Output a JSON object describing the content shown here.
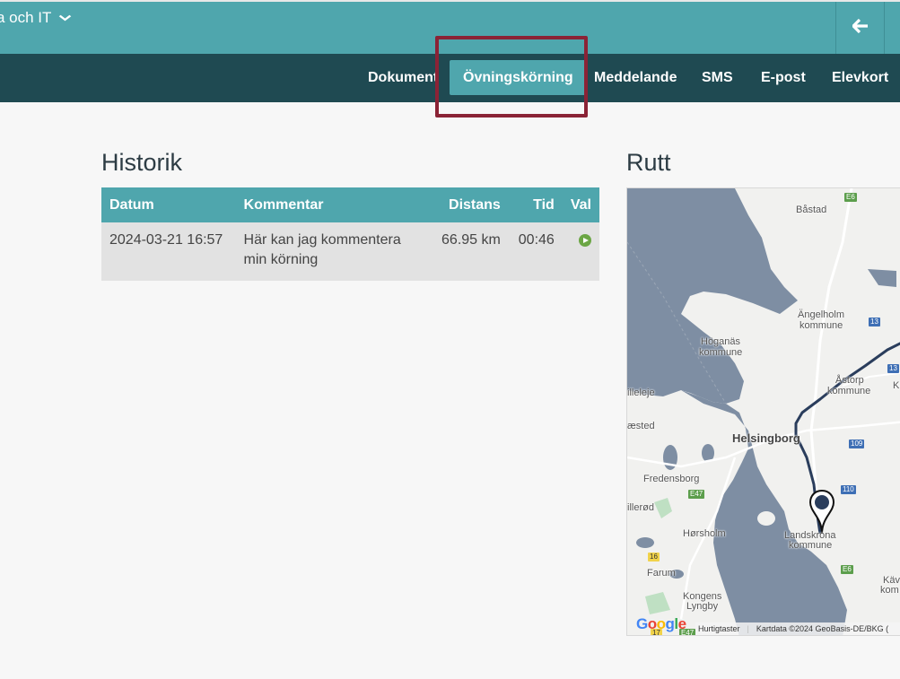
{
  "topbar": {
    "org_label": "a och IT",
    "back_icon": "arrow-left-icon"
  },
  "nav": {
    "items": [
      {
        "label": "Dokument"
      },
      {
        "label": "Övningskörning",
        "active": true
      },
      {
        "label": "Meddelande"
      },
      {
        "label": "SMS"
      },
      {
        "label": "E-post"
      },
      {
        "label": "Elevkort"
      }
    ]
  },
  "history": {
    "title": "Historik",
    "columns": [
      "Datum",
      "Kommentar",
      "Distans",
      "Tid",
      "Val"
    ],
    "rows": [
      {
        "datum": "2024-03-21 16:57",
        "kommentar": "Här kan jag kommentera min körning",
        "distans": "66.95 km",
        "tid": "00:46",
        "val_icon": "play-icon"
      }
    ]
  },
  "route": {
    "title": "Rutt",
    "map_labels": {
      "bastad": "Båstad",
      "angelholm_1": "Ängelholm",
      "angelholm_2": "kommune",
      "hoganas_1": "Höganäs",
      "hoganas_2": "kommune",
      "astorp_1": "Åstorp",
      "astorp_2": "kommune",
      "kl": "Kl",
      "lleleje": "illeleje",
      "aested": "æsted",
      "helsingborg": "Helsingborg",
      "fredensborg": "Fredensborg",
      "illerod": "illerød",
      "horsholm": "Hørsholm",
      "landskrona_1": "Landskrona",
      "landskrona_2": "kommune",
      "farum": "Farum",
      "kongens_1": "Kongens",
      "kongens_2": "Lyngby",
      "kav_1": "Käv",
      "kav_2": "kom"
    },
    "shields": {
      "e6_top": "E6",
      "r13_a": "13",
      "r13_b": "13",
      "r109": "109",
      "r110": "110",
      "e47": "E47",
      "r16": "16",
      "e6_bottom": "E6",
      "r17": "17",
      "e47_b": "E47"
    },
    "footer": {
      "google": "Google",
      "shortcuts": "Hurtigtaster",
      "attribution": "Kartdata ©2024 GeoBasis-DE/BKG ("
    },
    "marker_icon": "map-pin-icon"
  },
  "colors": {
    "topbar": "#4fa6ad",
    "navbar": "#1f4a52",
    "highlight": "#8b2336",
    "route_line": "#2a3d5c",
    "water": "#7e8ea3"
  }
}
